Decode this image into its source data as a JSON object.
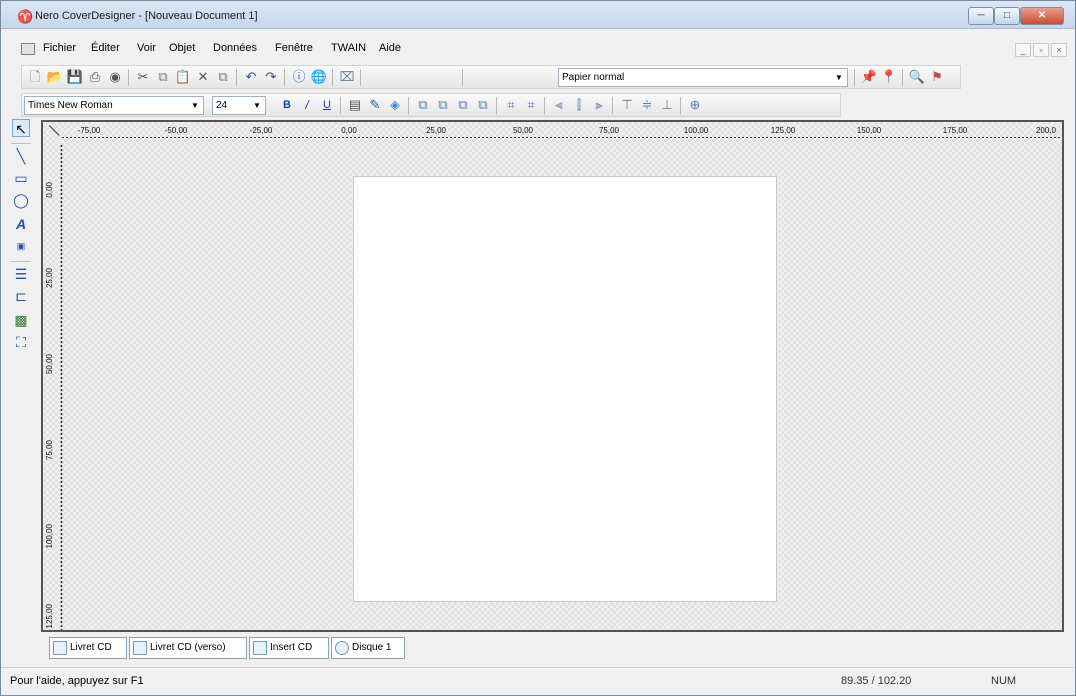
{
  "window": {
    "title": "Nero CoverDesigner - [Nouveau Document 1]"
  },
  "menu": [
    "Fichier",
    "Éditer",
    "Voir",
    "Objet",
    "Données",
    "Fenêtre",
    "TWAIN",
    "Aide"
  ],
  "toolbar": {
    "paper_select": "Papier normal"
  },
  "format": {
    "font_name": "Times New Roman",
    "font_size": "24",
    "bold_label": "B",
    "italic_label": "/",
    "underline_label": "U"
  },
  "ruler": {
    "h_ticks": [
      "-75,00",
      "-50,00",
      "-25,00",
      "0,00",
      "25,00",
      "50,00",
      "75,00",
      "100,00",
      "125,00",
      "150,00",
      "175,00",
      "200,0"
    ],
    "v_ticks": [
      "0,00",
      "25,00",
      "50,00",
      "75,00",
      "100,00",
      "125,00"
    ]
  },
  "tabs": [
    "Livret CD",
    "Livret CD (verso)",
    "Insert CD",
    "Disque 1"
  ],
  "status": {
    "help": "Pour l'aide, appuyez sur F1",
    "coords": "89.35 / 102.20",
    "num": "NUM"
  },
  "colors": {
    "titlebar": "#c6d7ec",
    "close_button": "#c84b33",
    "page": "#ffffff"
  }
}
